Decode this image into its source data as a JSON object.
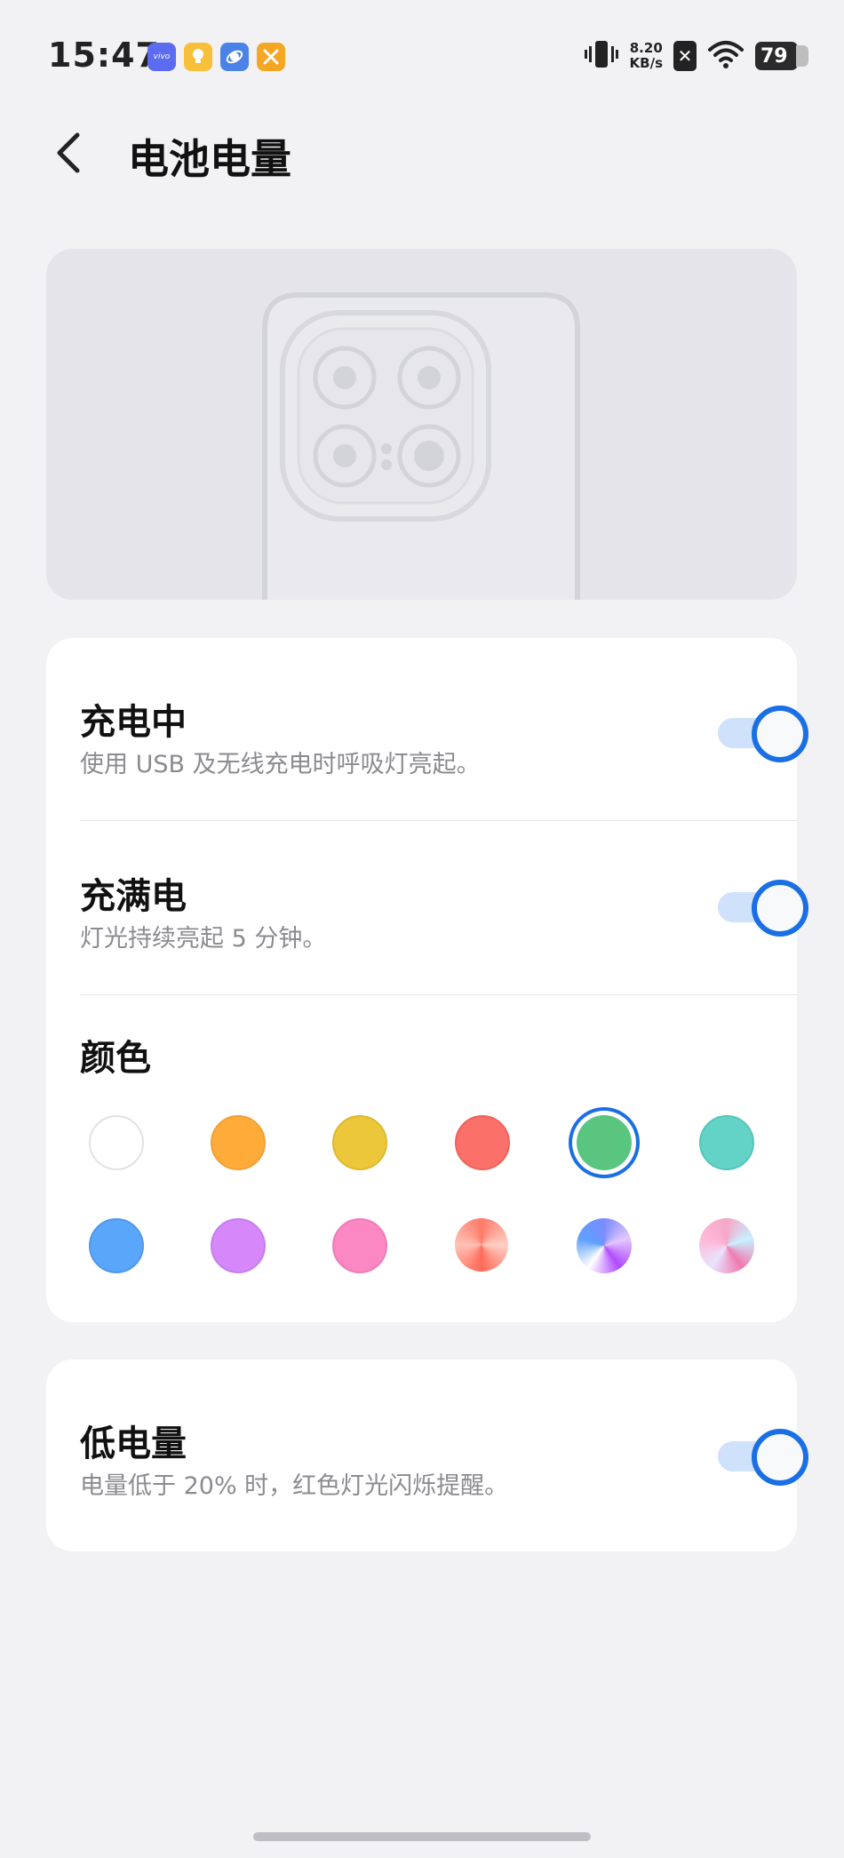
{
  "status_bar": {
    "time": "15:47",
    "net_speed_value": "8.20",
    "net_speed_unit": "KB/s",
    "battery_level": "79",
    "app_icons": [
      {
        "name": "vivo-app-icon",
        "label": "vivo",
        "color": "#5b6cf0"
      },
      {
        "name": "bulb-app-icon",
        "color": "#f7bf3a"
      },
      {
        "name": "planet-app-icon",
        "color": "#4b82e8"
      },
      {
        "name": "tools-app-icon",
        "color": "#f5a623"
      }
    ]
  },
  "header": {
    "title": "电池电量"
  },
  "settings": {
    "charging": {
      "title": "充电中",
      "subtitle": "使用 USB 及无线充电时呼吸灯亮起。",
      "enabled": true
    },
    "full": {
      "title": "充满电",
      "subtitle": "灯光持续亮起 5 分钟。",
      "enabled": true
    },
    "color": {
      "title": "颜色",
      "selected_index": 4,
      "options": [
        "#ffffff",
        "#ffab3a",
        "#ecc73a",
        "#fb7068",
        "#59c57f",
        "#62d3c6",
        "#5aa6fb",
        "#d688fb",
        "#fb88c3",
        "gradient-coral",
        "gradient-violet",
        "gradient-pastel"
      ]
    }
  },
  "low_battery": {
    "title": "低电量",
    "subtitle": "电量低于 20% 时，红色灯光闪烁提醒。",
    "enabled": true
  },
  "colors": {
    "accent": "#1a6fe5",
    "background": "#f2f2f5"
  }
}
